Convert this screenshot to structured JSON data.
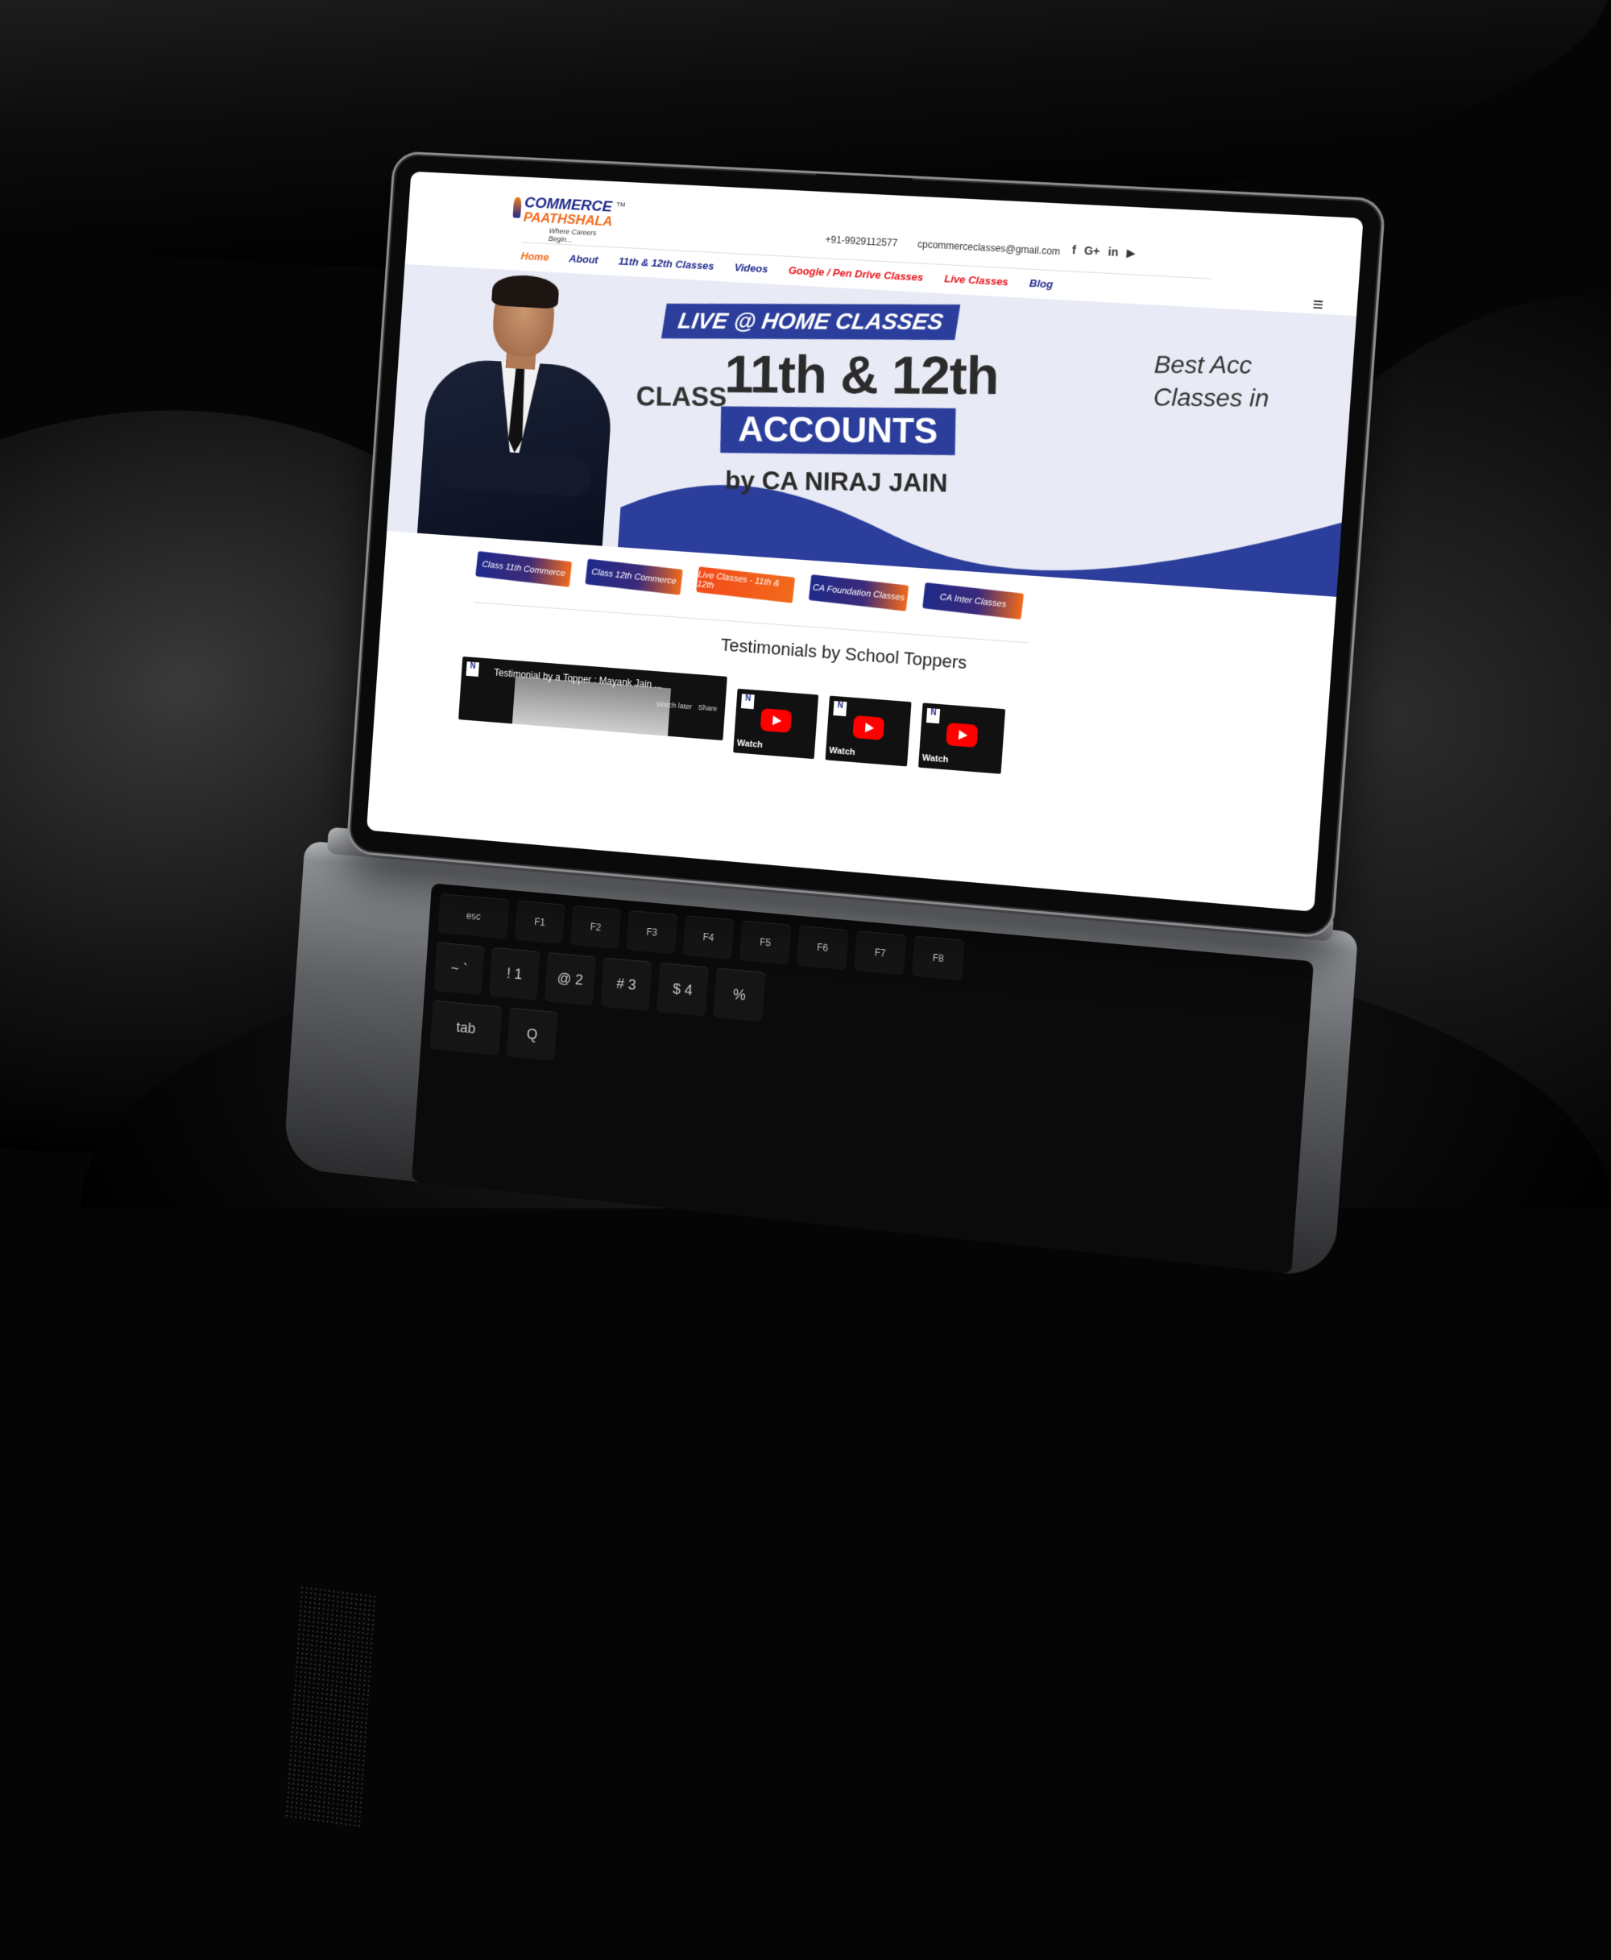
{
  "brand": {
    "name_top": "COMMERCE",
    "name_bottom": "PAATHSHALA",
    "trademark": "TM",
    "tagline": "Where Careers Begin..."
  },
  "header": {
    "phone": "+91-9929112577",
    "email": "cpcommerceclasses@gmail.com",
    "social": [
      {
        "icon": "facebook-icon",
        "glyph": "f"
      },
      {
        "icon": "google-plus-icon",
        "glyph": "G+"
      },
      {
        "icon": "linkedin-icon",
        "glyph": "in"
      },
      {
        "icon": "youtube-icon",
        "glyph": "▶"
      }
    ],
    "menu_glyph": "≡"
  },
  "nav": [
    {
      "label": "Home",
      "color": "#f26a1b"
    },
    {
      "label": "About",
      "color": "#1f2a8a"
    },
    {
      "label": "11th & 12th Classes",
      "color": "#1f2a8a"
    },
    {
      "label": "Videos",
      "color": "#1f2a8a"
    },
    {
      "label": "Google / Pen Drive Classes",
      "color": "#e8141b"
    },
    {
      "label": "Live Classes",
      "color": "#e8141b"
    },
    {
      "label": "Blog",
      "color": "#1f2a8a"
    }
  ],
  "hero": {
    "tag": "LIVE @ HOME CLASSES",
    "class_word": "CLASS",
    "grades": "11th & 12th",
    "subject": "ACCOUNTS",
    "by": "by CA NIRAJ JAIN",
    "side_line1": "Best Acc",
    "side_line2": "Classes in"
  },
  "buttons": [
    {
      "label": "Class 11th Commerce",
      "style": "gradient"
    },
    {
      "label": "Class 12th Commerce",
      "style": "gradient"
    },
    {
      "label": "Live Classes - 11th & 12th",
      "style": "orange"
    },
    {
      "label": "CA Foundation Classes",
      "style": "gradient"
    },
    {
      "label": "CA Inter Classes",
      "style": "gradient"
    }
  ],
  "testimonials": {
    "heading": "Testimonials by School Toppers",
    "featured": {
      "title": "Testimonial by a Topper : Mayank Jain ...",
      "watch_later": "Watch later",
      "share": "Share"
    },
    "thumbs": [
      {
        "label": "Watch"
      },
      {
        "label": "Watch"
      },
      {
        "label": "Watch"
      }
    ]
  },
  "keyboard": {
    "fn_row": [
      "esc",
      "F1",
      "F2",
      "F3",
      "F4",
      "F5",
      "F6",
      "F7",
      "F8"
    ],
    "num_row": [
      "~ `",
      "! 1",
      "@ 2",
      "# 3",
      "$ 4",
      "%"
    ],
    "tab_row": [
      "tab",
      "Q"
    ]
  },
  "colors": {
    "brand_blue": "#1f2a8a",
    "brand_orange": "#f26a1b",
    "hero_bg": "#e8ebf5",
    "accent_red": "#e8141b"
  }
}
